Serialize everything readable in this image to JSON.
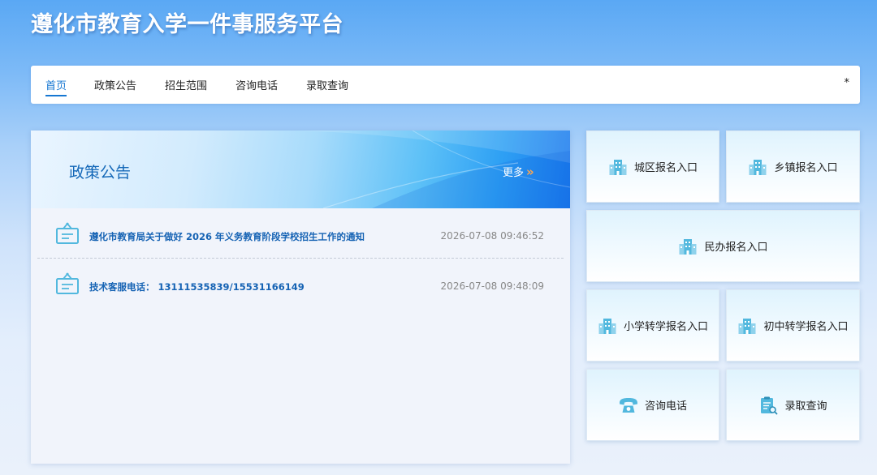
{
  "site": {
    "title": "遵化市教育入学一件事服务平台"
  },
  "nav": {
    "items": [
      {
        "label": "首页",
        "active": true
      },
      {
        "label": "政策公告"
      },
      {
        "label": "招生范围"
      },
      {
        "label": "咨询电话"
      },
      {
        "label": "录取查询"
      }
    ],
    "star": "*"
  },
  "policy": {
    "title": "政策公告",
    "more": "更多",
    "more_chevron": "»",
    "items": [
      {
        "text": "遵化市教育局关于做好 2026 年义务教育阶段学校招生工作的通知",
        "date": "2026-07-08 09:46:52",
        "icon": "notice-board-icon"
      },
      {
        "text": "技术客服电话：  13111535839/15531166149",
        "date": "2026-07-08 09:48:09",
        "icon": "notice-board-icon"
      }
    ]
  },
  "entries": [
    {
      "label": "城区报名入口",
      "icon": "school-building-icon"
    },
    {
      "label": "乡镇报名入口",
      "icon": "school-building-icon"
    },
    {
      "label": "民办报名入口",
      "icon": "school-building-icon"
    },
    {
      "label": "小学转学报名入口",
      "icon": "school-building-icon"
    },
    {
      "label": "初中转学报名入口",
      "icon": "school-building-icon"
    },
    {
      "label": "咨询电话",
      "icon": "telephone-icon"
    },
    {
      "label": "录取查询",
      "icon": "clipboard-search-icon"
    }
  ],
  "colors": {
    "accent": "#1677d2",
    "link": "#1663b4",
    "policy_title": "#1468b8",
    "more_chevron": "#ffa64d",
    "icon": "#52b8de"
  }
}
